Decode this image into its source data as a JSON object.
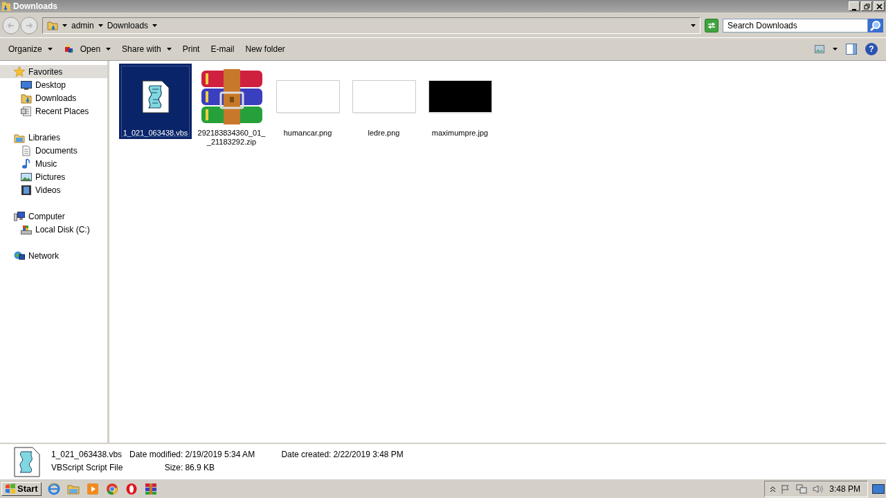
{
  "window": {
    "title": "Downloads"
  },
  "address_bar": {
    "breadcrumbs": [
      "admin",
      "Downloads"
    ],
    "search": {
      "placeholder": "Search Downloads"
    }
  },
  "toolbar": {
    "buttons": [
      {
        "label": "Organize",
        "dropdown": true
      },
      {
        "label": "Open",
        "dropdown": true
      },
      {
        "label": "Share with",
        "dropdown": true
      },
      {
        "label": "Print",
        "dropdown": false
      },
      {
        "label": "E-mail",
        "dropdown": false
      },
      {
        "label": "New folder",
        "dropdown": false
      }
    ],
    "help": "?"
  },
  "sidebar": {
    "groups": [
      {
        "label": "Favorites",
        "selected": true,
        "children": [
          {
            "label": "Desktop",
            "selected": false
          },
          {
            "label": "Downloads",
            "selected": false
          },
          {
            "label": "Recent Places",
            "selected": false
          }
        ]
      },
      {
        "label": "Libraries",
        "selected": false,
        "children": [
          {
            "label": "Documents",
            "selected": false
          },
          {
            "label": "Music",
            "selected": false
          },
          {
            "label": "Pictures",
            "selected": false
          },
          {
            "label": "Videos",
            "selected": false
          }
        ]
      },
      {
        "label": "Computer",
        "selected": false,
        "children": [
          {
            "label": "Local Disk (C:)",
            "selected": false
          }
        ]
      },
      {
        "label": "Network",
        "selected": false
      }
    ]
  },
  "files": [
    {
      "name": "1_021_063438.vbs",
      "kind": "script",
      "selected": true
    },
    {
      "name": "292183834360_01__21183292.zip",
      "kind": "archive",
      "selected": false
    },
    {
      "name": "humancar.png",
      "kind": "picture",
      "selected": false
    },
    {
      "name": "ledre.png",
      "kind": "picture",
      "selected": false
    },
    {
      "name": "maximumpre.jpg",
      "kind": "picture",
      "selected": false
    }
  ],
  "details": {
    "name": "1_021_063438.vbs",
    "type": "VBScript Script File",
    "fields": [
      {
        "label": "Date modified:",
        "value": "2/19/2019 5:34 AM"
      },
      {
        "label": "Date created:",
        "value": "2/22/2019 3:48 PM"
      },
      {
        "label": "Size:",
        "value": "86.9 KB"
      }
    ]
  },
  "taskbar": {
    "start": "Start",
    "clock": "3:48 PM"
  }
}
